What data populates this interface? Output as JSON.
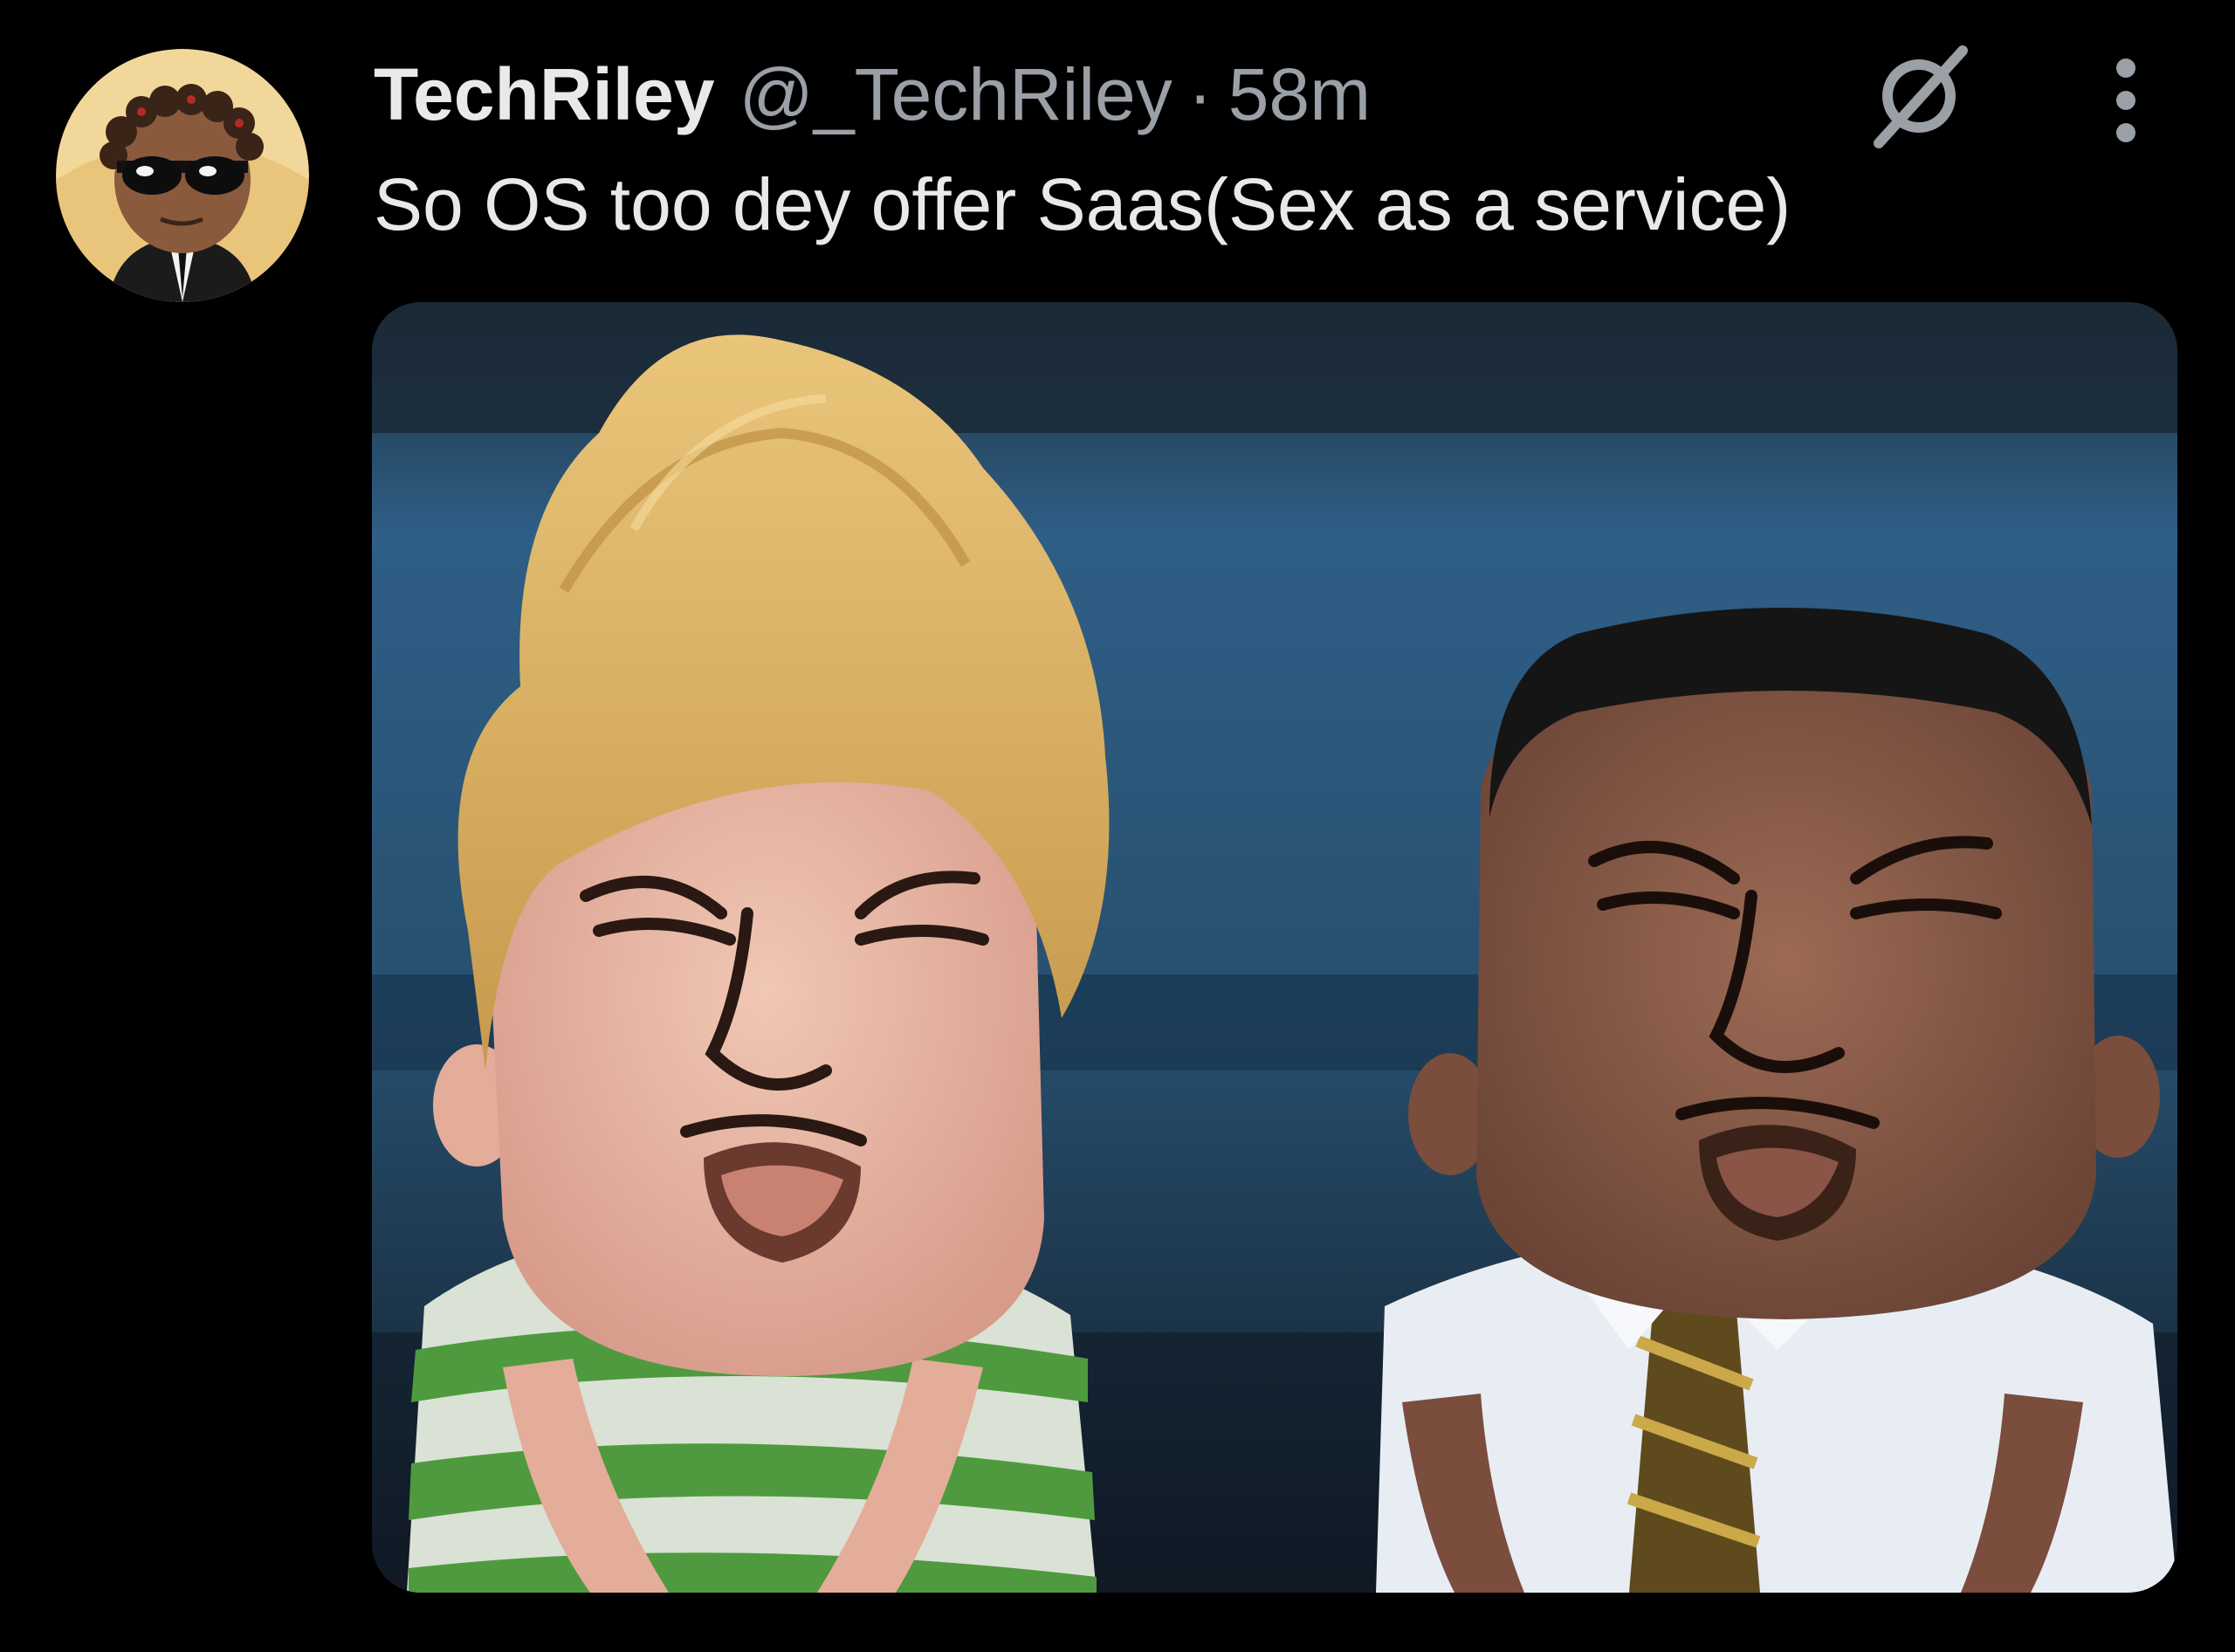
{
  "post": {
    "author": {
      "display_name": "TechRiley",
      "handle": "@_TechRiley",
      "avatar_icon": "cartoon-avatar-sunglasses"
    },
    "separator": "·",
    "timestamp": "58m",
    "text": "So OS too dey offer Saas(Sex as a service)",
    "actions": {
      "grok_icon": "grok-slash-icon",
      "more_icon": "vertical-ellipsis-icon"
    },
    "media": {
      "kind": "image",
      "description_icon": "two-cartoon-boys-scrunched-faces"
    }
  },
  "colors": {
    "background": "#000000",
    "primary_text": "#e7e9ea",
    "secondary_text": "#9aa0a6"
  }
}
